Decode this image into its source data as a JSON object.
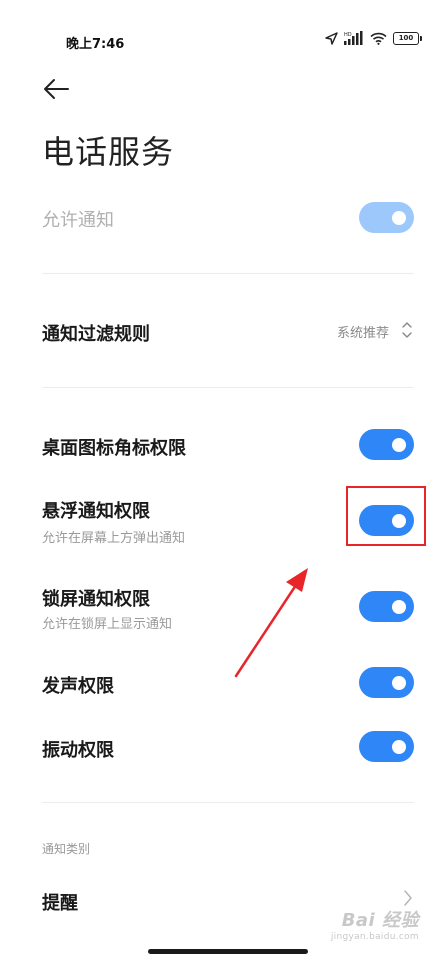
{
  "status_bar": {
    "time": "晚上7:46",
    "battery": "100"
  },
  "page": {
    "title": "电话服务"
  },
  "allow_notify": {
    "label": "允许通知",
    "enabled": true,
    "disabled_state": true
  },
  "filter_rule": {
    "label": "通知过滤规则",
    "value": "系统推荐"
  },
  "toggles": [
    {
      "label": "桌面图标角标权限",
      "sublabel": "",
      "on": true
    },
    {
      "label": "悬浮通知权限",
      "sublabel": "允许在屏幕上方弹出通知",
      "on": true
    },
    {
      "label": "锁屏通知权限",
      "sublabel": "允许在锁屏上显示通知",
      "on": true
    },
    {
      "label": "发声权限",
      "sublabel": "",
      "on": true
    },
    {
      "label": "振动权限",
      "sublabel": "",
      "on": true
    }
  ],
  "category": {
    "header": "通知类别",
    "item_label": "提醒"
  },
  "watermark": {
    "main": "Bai 经验",
    "url": "jingyan.baidu.com"
  },
  "colors": {
    "accent": "#2f86f6",
    "accent_disabled": "#9cc8fb",
    "annotation": "#e8262a"
  }
}
